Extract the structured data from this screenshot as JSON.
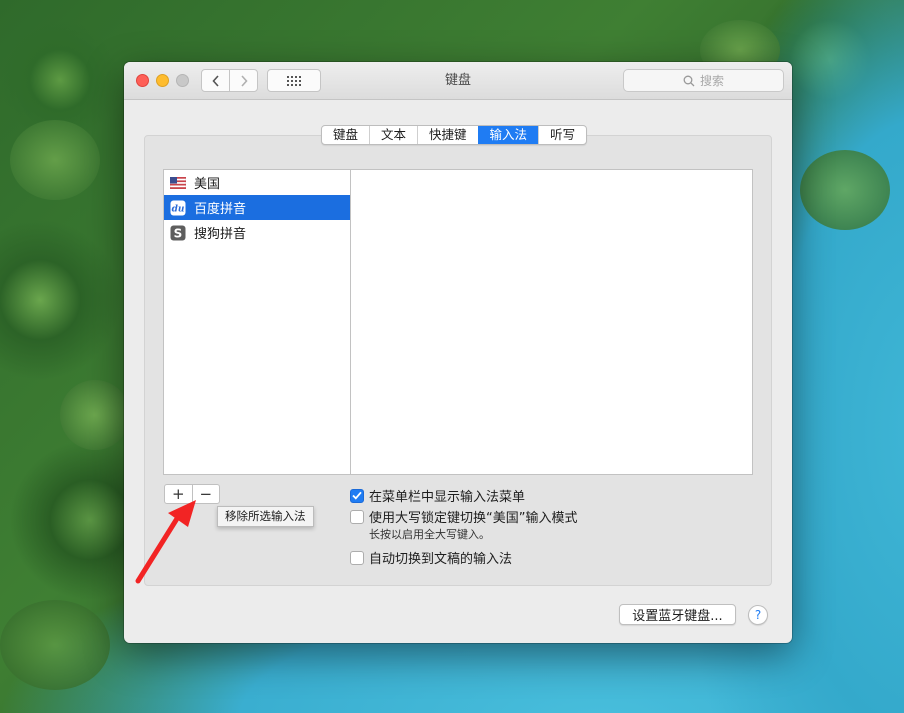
{
  "window": {
    "title": "键盘"
  },
  "search": {
    "placeholder": "搜索"
  },
  "tabs": [
    {
      "label": "键盘",
      "active": false
    },
    {
      "label": "文本",
      "active": false
    },
    {
      "label": "快捷键",
      "active": false
    },
    {
      "label": "输入法",
      "active": true
    },
    {
      "label": "听写",
      "active": false
    }
  ],
  "input_sources": [
    {
      "label": "美国",
      "icon": "us-flag-icon",
      "selected": false
    },
    {
      "label": "百度拼音",
      "icon": "baidu-du-icon",
      "selected": true
    },
    {
      "label": "搜狗拼音",
      "icon": "sogou-s-icon",
      "selected": false
    }
  ],
  "controls": {
    "add": "+",
    "remove": "−"
  },
  "tooltip": "移除所选输入法",
  "options": {
    "show_menu": {
      "label": "在菜单栏中显示输入法菜单",
      "checked": true
    },
    "caps_lock": {
      "label": "使用大写锁定键切换“美国”输入模式",
      "checked": false,
      "hint": "长按以启用全大写键入。"
    },
    "auto_switch": {
      "label": "自动切换到文稿的输入法",
      "checked": false
    }
  },
  "buttons": {
    "bluetooth": "设置蓝牙键盘...",
    "help": "?"
  },
  "colors": {
    "accent": "#1f7cf3",
    "selection": "#1b6ee0",
    "annotation_arrow": "#f22424"
  }
}
